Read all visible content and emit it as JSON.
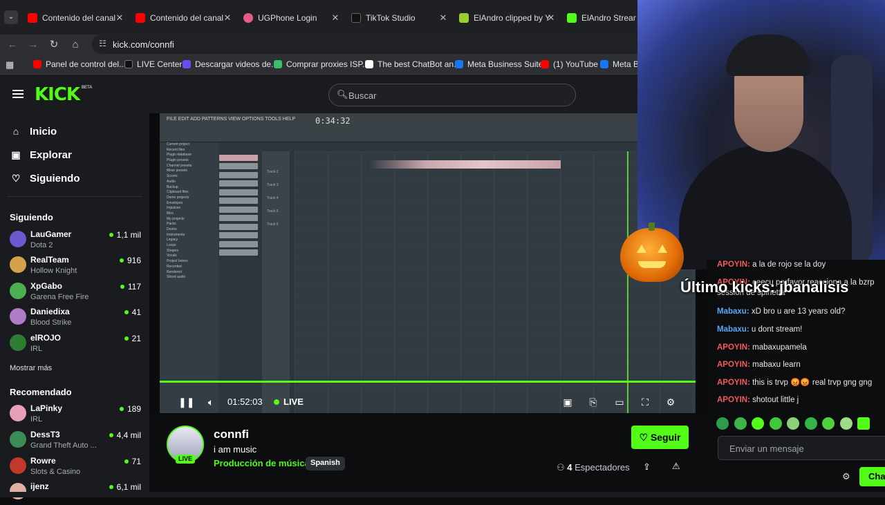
{
  "browser": {
    "tabs": [
      {
        "title": "Contenido del canal",
        "favicon_color": "#ff0000"
      },
      {
        "title": "Contenido del canal",
        "favicon_color": "#ff0000"
      },
      {
        "title": "UGPhone Login",
        "favicon_color": "#e85b86"
      },
      {
        "title": "TikTok Studio",
        "favicon_color": "#111111"
      },
      {
        "title": "ElAndro clipped by Y",
        "favicon_color": "#9acd32"
      },
      {
        "title": "ElAndro Stream - V",
        "favicon_color": "#53fc18"
      }
    ],
    "url": "kick.com/connfi",
    "bookmarks": [
      {
        "label": "Panel de control del...",
        "color": "#ff0000"
      },
      {
        "label": "LIVE Center",
        "color": "#111111"
      },
      {
        "label": "Descargar videos de...",
        "color": "#6a4cf0"
      },
      {
        "label": "Comprar proxies ISP...",
        "color": "#3dbd6b"
      },
      {
        "label": "The best ChatBot an...",
        "color": "#ffffff"
      },
      {
        "label": "Meta Business Suite",
        "color": "#1877f2"
      },
      {
        "label": "(1) YouTube",
        "color": "#ff0000"
      },
      {
        "label": "Meta Bu",
        "color": "#1877f2"
      }
    ]
  },
  "header": {
    "logo": "KICK",
    "logo_badge": "BETA",
    "search_placeholder": "Buscar"
  },
  "sidebar": {
    "nav": [
      {
        "label": "Inicio",
        "icon": "home-icon",
        "glyph": "⌂"
      },
      {
        "label": "Explorar",
        "icon": "browse-icon",
        "glyph": "▣"
      },
      {
        "label": "Siguiendo",
        "icon": "heart-icon",
        "glyph": "♡"
      }
    ],
    "following_title": "Siguiendo",
    "following": [
      {
        "name": "LauGamer",
        "category": "Dota 2",
        "viewers": "1,1 mil",
        "avatar_color": "#6a5acd"
      },
      {
        "name": "RealTeam",
        "category": "Hollow Knight",
        "viewers": "916",
        "avatar_color": "#d4a24c"
      },
      {
        "name": "XpGabo",
        "category": "Garena Free Fire",
        "viewers": "117",
        "avatar_color": "#4caf50"
      },
      {
        "name": "Daniedixa",
        "category": "Blood Strike",
        "viewers": "41",
        "avatar_color": "#b07cc6"
      },
      {
        "name": "elROJO",
        "category": "IRL",
        "viewers": "21",
        "avatar_color": "#2e7d32"
      }
    ],
    "show_more": "Mostrar más",
    "recommended_title": "Recomendado",
    "recommended": [
      {
        "name": "LaPinky",
        "category": "IRL",
        "viewers": "189",
        "avatar_color": "#e6a1b8"
      },
      {
        "name": "DessT3",
        "category": "Grand Theft Auto ...",
        "viewers": "4,4 mil",
        "avatar_color": "#3c8c5a"
      },
      {
        "name": "Rowre",
        "category": "Slots & Casino",
        "viewers": "71",
        "avatar_color": "#c0392b"
      },
      {
        "name": "ijenz",
        "category": "",
        "viewers": "6,1 mil",
        "avatar_color": "#e0b0a0"
      }
    ]
  },
  "player": {
    "time": "01:52:03",
    "live_label": "LIVE",
    "overlay_text": "Último kicks: jbanalisis",
    "fl_time": "0:34:32"
  },
  "chat": {
    "messages": [
      {
        "user": "APOYIN:",
        "text": " a la de rojo se la doy",
        "color": "#f55a5a"
      },
      {
        "user": "APOYIN:",
        "text": " ceecu porfavor reacciona a la bzrp session de spinetta",
        "color": "#f55a5a"
      },
      {
        "user": "Mabaxu:",
        "text": " xD bro u are 13 years old?",
        "color": "#5aa7f5"
      },
      {
        "user": "Mabaxu:",
        "text": " u dont stream!",
        "color": "#5aa7f5"
      },
      {
        "user": "APOYIN:",
        "text": " mabaxupamela",
        "color": "#f55a5a"
      },
      {
        "user": "APOYIN:",
        "text": " mabaxu learn",
        "color": "#f55a5a"
      },
      {
        "user": "APOYIN:",
        "text": " this is trvp 😡😡 real trvp gng gng",
        "color": "#f55a5a"
      },
      {
        "user": "APOYIN:",
        "text": " shotout little j",
        "color": "#f55a5a"
      }
    ],
    "input_placeholder": "Enviar un mensaje",
    "send_label": "Chat"
  },
  "channel": {
    "name": "connfi",
    "title": "i am music",
    "category": "Producción de música",
    "language": "Spanish",
    "live_badge": "LIVE",
    "follow_label": "Seguir",
    "viewers_count": "4",
    "viewers_label": "Espectadores"
  },
  "colors": {
    "accent": "#53fc18",
    "background": "#0b0d0e",
    "sidebar": "#191b1f"
  }
}
